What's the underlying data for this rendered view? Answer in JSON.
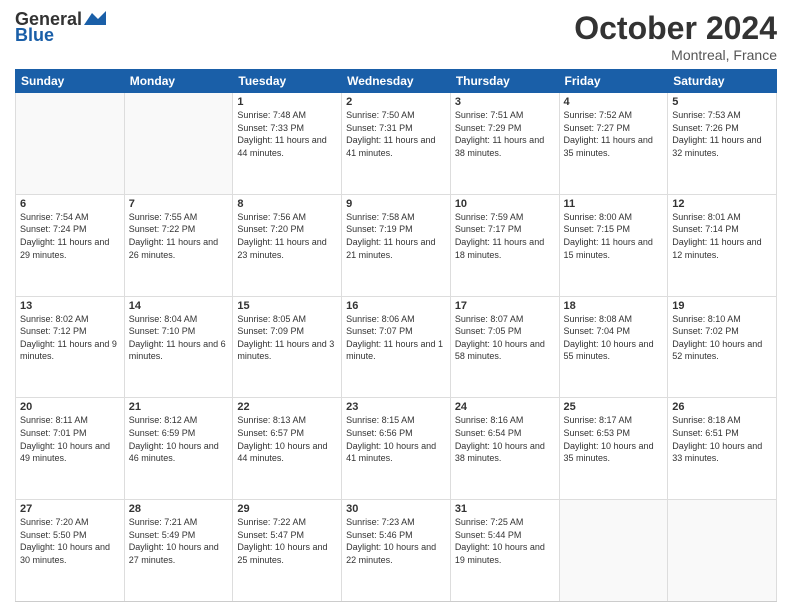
{
  "header": {
    "logo_general": "General",
    "logo_blue": "Blue",
    "month": "October 2024",
    "location": "Montreal, France"
  },
  "days_of_week": [
    "Sunday",
    "Monday",
    "Tuesday",
    "Wednesday",
    "Thursday",
    "Friday",
    "Saturday"
  ],
  "weeks": [
    [
      {
        "day": "",
        "info": ""
      },
      {
        "day": "",
        "info": ""
      },
      {
        "day": "1",
        "info": "Sunrise: 7:48 AM\nSunset: 7:33 PM\nDaylight: 11 hours and 44 minutes."
      },
      {
        "day": "2",
        "info": "Sunrise: 7:50 AM\nSunset: 7:31 PM\nDaylight: 11 hours and 41 minutes."
      },
      {
        "day": "3",
        "info": "Sunrise: 7:51 AM\nSunset: 7:29 PM\nDaylight: 11 hours and 38 minutes."
      },
      {
        "day": "4",
        "info": "Sunrise: 7:52 AM\nSunset: 7:27 PM\nDaylight: 11 hours and 35 minutes."
      },
      {
        "day": "5",
        "info": "Sunrise: 7:53 AM\nSunset: 7:26 PM\nDaylight: 11 hours and 32 minutes."
      }
    ],
    [
      {
        "day": "6",
        "info": "Sunrise: 7:54 AM\nSunset: 7:24 PM\nDaylight: 11 hours and 29 minutes."
      },
      {
        "day": "7",
        "info": "Sunrise: 7:55 AM\nSunset: 7:22 PM\nDaylight: 11 hours and 26 minutes."
      },
      {
        "day": "8",
        "info": "Sunrise: 7:56 AM\nSunset: 7:20 PM\nDaylight: 11 hours and 23 minutes."
      },
      {
        "day": "9",
        "info": "Sunrise: 7:58 AM\nSunset: 7:19 PM\nDaylight: 11 hours and 21 minutes."
      },
      {
        "day": "10",
        "info": "Sunrise: 7:59 AM\nSunset: 7:17 PM\nDaylight: 11 hours and 18 minutes."
      },
      {
        "day": "11",
        "info": "Sunrise: 8:00 AM\nSunset: 7:15 PM\nDaylight: 11 hours and 15 minutes."
      },
      {
        "day": "12",
        "info": "Sunrise: 8:01 AM\nSunset: 7:14 PM\nDaylight: 11 hours and 12 minutes."
      }
    ],
    [
      {
        "day": "13",
        "info": "Sunrise: 8:02 AM\nSunset: 7:12 PM\nDaylight: 11 hours and 9 minutes."
      },
      {
        "day": "14",
        "info": "Sunrise: 8:04 AM\nSunset: 7:10 PM\nDaylight: 11 hours and 6 minutes."
      },
      {
        "day": "15",
        "info": "Sunrise: 8:05 AM\nSunset: 7:09 PM\nDaylight: 11 hours and 3 minutes."
      },
      {
        "day": "16",
        "info": "Sunrise: 8:06 AM\nSunset: 7:07 PM\nDaylight: 11 hours and 1 minute."
      },
      {
        "day": "17",
        "info": "Sunrise: 8:07 AM\nSunset: 7:05 PM\nDaylight: 10 hours and 58 minutes."
      },
      {
        "day": "18",
        "info": "Sunrise: 8:08 AM\nSunset: 7:04 PM\nDaylight: 10 hours and 55 minutes."
      },
      {
        "day": "19",
        "info": "Sunrise: 8:10 AM\nSunset: 7:02 PM\nDaylight: 10 hours and 52 minutes."
      }
    ],
    [
      {
        "day": "20",
        "info": "Sunrise: 8:11 AM\nSunset: 7:01 PM\nDaylight: 10 hours and 49 minutes."
      },
      {
        "day": "21",
        "info": "Sunrise: 8:12 AM\nSunset: 6:59 PM\nDaylight: 10 hours and 46 minutes."
      },
      {
        "day": "22",
        "info": "Sunrise: 8:13 AM\nSunset: 6:57 PM\nDaylight: 10 hours and 44 minutes."
      },
      {
        "day": "23",
        "info": "Sunrise: 8:15 AM\nSunset: 6:56 PM\nDaylight: 10 hours and 41 minutes."
      },
      {
        "day": "24",
        "info": "Sunrise: 8:16 AM\nSunset: 6:54 PM\nDaylight: 10 hours and 38 minutes."
      },
      {
        "day": "25",
        "info": "Sunrise: 8:17 AM\nSunset: 6:53 PM\nDaylight: 10 hours and 35 minutes."
      },
      {
        "day": "26",
        "info": "Sunrise: 8:18 AM\nSunset: 6:51 PM\nDaylight: 10 hours and 33 minutes."
      }
    ],
    [
      {
        "day": "27",
        "info": "Sunrise: 7:20 AM\nSunset: 5:50 PM\nDaylight: 10 hours and 30 minutes."
      },
      {
        "day": "28",
        "info": "Sunrise: 7:21 AM\nSunset: 5:49 PM\nDaylight: 10 hours and 27 minutes."
      },
      {
        "day": "29",
        "info": "Sunrise: 7:22 AM\nSunset: 5:47 PM\nDaylight: 10 hours and 25 minutes."
      },
      {
        "day": "30",
        "info": "Sunrise: 7:23 AM\nSunset: 5:46 PM\nDaylight: 10 hours and 22 minutes."
      },
      {
        "day": "31",
        "info": "Sunrise: 7:25 AM\nSunset: 5:44 PM\nDaylight: 10 hours and 19 minutes."
      },
      {
        "day": "",
        "info": ""
      },
      {
        "day": "",
        "info": ""
      }
    ]
  ]
}
